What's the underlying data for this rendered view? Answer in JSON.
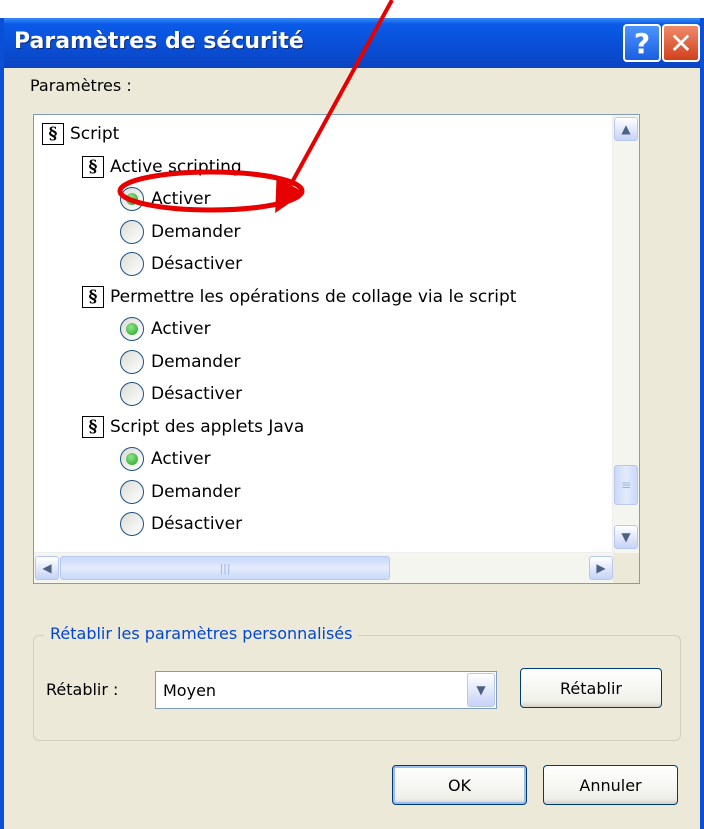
{
  "window": {
    "title": "Paramètres de sécurité",
    "help_label": "?",
    "close_label": "✕"
  },
  "settings": {
    "label": "Paramètres :",
    "tree": [
      {
        "kind": "category",
        "label": "Script",
        "icon": "script-settings-icon"
      },
      {
        "kind": "setting",
        "label": "Active scripting",
        "icon": "script-settings-icon"
      },
      {
        "kind": "option",
        "label": "Activer",
        "selected": true
      },
      {
        "kind": "option",
        "label": "Demander",
        "selected": false
      },
      {
        "kind": "option",
        "label": "Désactiver",
        "selected": false
      },
      {
        "kind": "setting",
        "label": "Permettre les opérations de collage via le script",
        "icon": "script-settings-icon"
      },
      {
        "kind": "option",
        "label": "Activer",
        "selected": true
      },
      {
        "kind": "option",
        "label": "Demander",
        "selected": false
      },
      {
        "kind": "option",
        "label": "Désactiver",
        "selected": false
      },
      {
        "kind": "setting",
        "label": "Script des applets Java",
        "icon": "script-settings-icon"
      },
      {
        "kind": "option",
        "label": "Activer",
        "selected": true
      },
      {
        "kind": "option",
        "label": "Demander",
        "selected": false
      },
      {
        "kind": "option",
        "label": "Désactiver",
        "selected": false
      }
    ]
  },
  "reset_group": {
    "legend": "Rétablir les paramètres personnalisés",
    "label": "Rétablir :",
    "combo_value": "Moyen",
    "reset_button": "Rétablir"
  },
  "buttons": {
    "ok": "OK",
    "cancel": "Annuler"
  },
  "annotation": {
    "color": "#e60000",
    "target": "Active scripting"
  }
}
